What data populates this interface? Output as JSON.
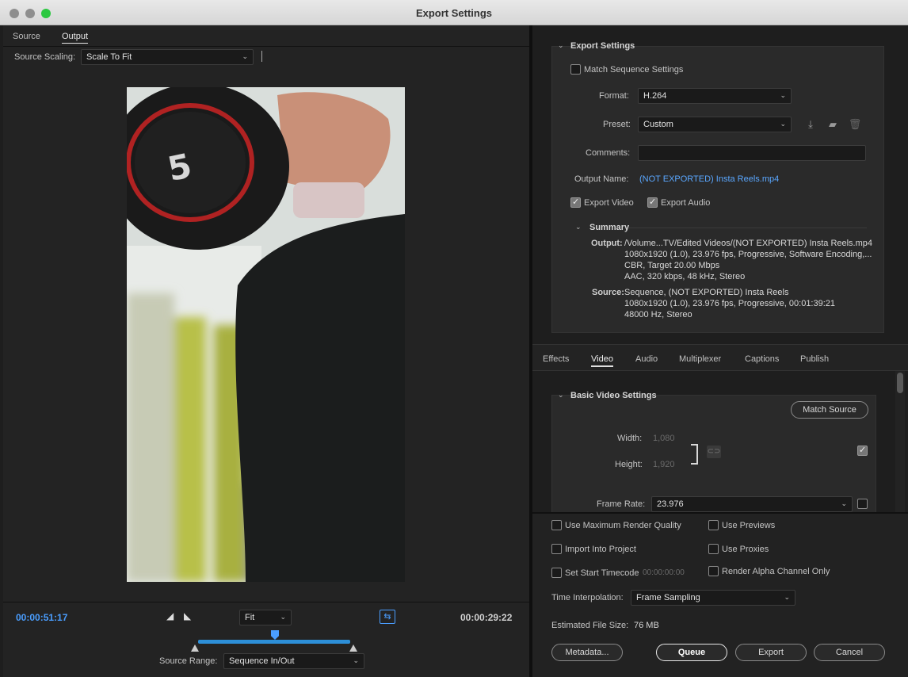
{
  "window": {
    "title": "Export Settings"
  },
  "left": {
    "tabs": [
      {
        "label": "Source"
      },
      {
        "label": "Output"
      }
    ],
    "source_scaling": {
      "label": "Source Scaling:",
      "value": "Scale To Fit"
    },
    "timecode_current": "00:00:51:17",
    "timecode_duration": "00:00:29:22",
    "fit_select": "Fit",
    "source_range": {
      "label": "Source Range:",
      "value": "Sequence In/Out"
    }
  },
  "export_settings": {
    "header": "Export Settings",
    "match_sequence": "Match Sequence Settings",
    "format": {
      "label": "Format:",
      "value": "H.264"
    },
    "preset": {
      "label": "Preset:",
      "value": "Custom"
    },
    "comments": {
      "label": "Comments:",
      "value": ""
    },
    "output_name": {
      "label": "Output Name:",
      "value": "(NOT EXPORTED) Insta Reels.mp4"
    },
    "export_video": "Export Video",
    "export_audio": "Export Audio",
    "summary": {
      "header": "Summary",
      "output_label": "Output:",
      "output_lines": [
        "/Volume...TV/Edited Videos/(NOT EXPORTED) Insta Reels.mp4",
        "1080x1920 (1.0), 23.976 fps, Progressive, Software Encoding,...",
        "CBR, Target 20.00 Mbps",
        "AAC, 320 kbps, 48 kHz, Stereo"
      ],
      "source_label": "Source:",
      "source_lines": [
        "Sequence, (NOT EXPORTED) Insta Reels",
        "1080x1920 (1.0), 23.976 fps, Progressive, 00:01:39:21",
        "48000 Hz, Stereo"
      ]
    }
  },
  "tabs": [
    {
      "label": "Effects"
    },
    {
      "label": "Video"
    },
    {
      "label": "Audio"
    },
    {
      "label": "Multiplexer"
    },
    {
      "label": "Captions"
    },
    {
      "label": "Publish"
    }
  ],
  "video": {
    "header": "Basic Video Settings",
    "match_source": "Match Source",
    "width": {
      "label": "Width:",
      "value": "1,080"
    },
    "height": {
      "label": "Height:",
      "value": "1,920"
    },
    "frame_rate": {
      "label": "Frame Rate:",
      "value": "23.976"
    }
  },
  "options": {
    "max_render": "Use Maximum Render Quality",
    "use_previews": "Use Previews",
    "import_project": "Import Into Project",
    "use_proxies": "Use Proxies",
    "start_timecode": "Set Start Timecode",
    "start_timecode_value": "00:00:00:00",
    "render_alpha": "Render Alpha Channel Only",
    "time_interp": {
      "label": "Time Interpolation:",
      "value": "Frame Sampling"
    },
    "est_size": {
      "label": "Estimated File Size:",
      "value": "76 MB"
    }
  },
  "buttons": {
    "metadata": "Metadata...",
    "queue": "Queue",
    "export": "Export",
    "cancel": "Cancel"
  },
  "colors": {
    "accent_blue": "#4a9eff",
    "link_blue": "#5aa7ff"
  }
}
